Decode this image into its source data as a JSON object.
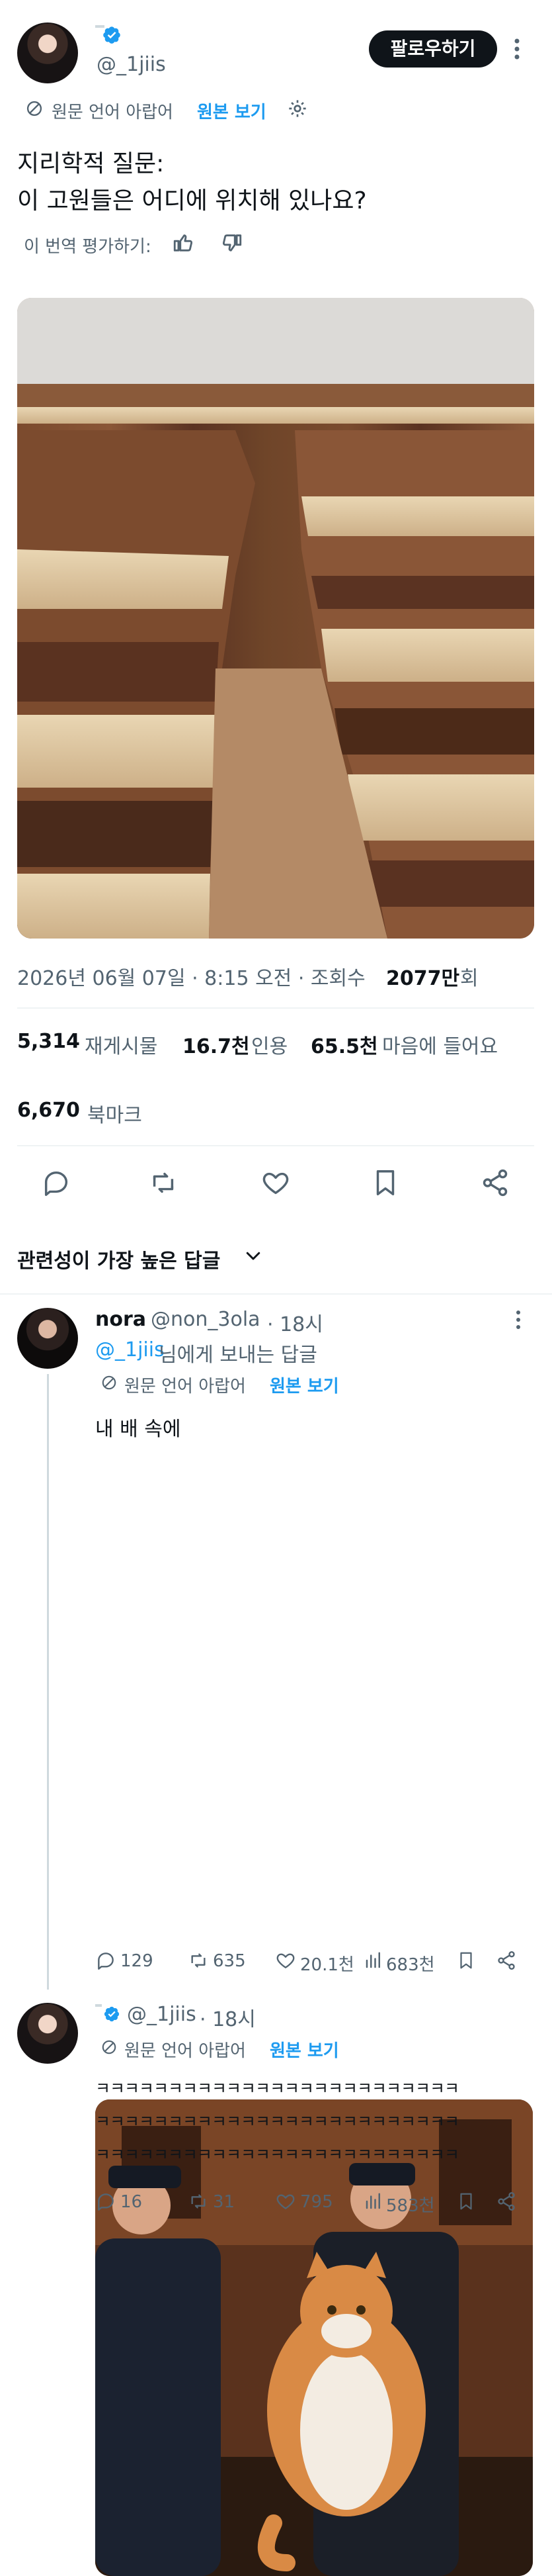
{
  "post": {
    "handle": "@_1jiis",
    "follow_label": "팔로우하기",
    "source_lang": "원문 언어 아랍어",
    "view_original": "원본 보기",
    "body_line1": "지리학적 질문:",
    "body_line2": "이 고원들은 어디에 위치해 있나요?",
    "rate_translation": "이 번역 평가하기:",
    "timestamp": "2026년 06월 07일 · 8:15 오전 · 조회수",
    "views_num": "2077만",
    "views_unit": "회",
    "stats": {
      "reposts_num": "5,314",
      "reposts_label": "재게시물",
      "quotes_num": "16.7천",
      "quotes_label": "인용",
      "likes_num": "65.5천",
      "likes_label": "마음에 들어요",
      "bookmarks_num": "6,670",
      "bookmarks_label": "북마크"
    },
    "sort_label": "관련성이 가장 높은 답글"
  },
  "reply1": {
    "name": "nora",
    "handle": "@non_3ola",
    "time": "· 18시",
    "reply_to_handle": "@_1jiis",
    "reply_to_suffix": " 님에게 보내는 답글",
    "source_lang": "원문 언어 아랍어",
    "view_original": "원본 보기",
    "text": "내 배 속에",
    "actions": {
      "replies": "129",
      "reposts": "635",
      "likes": "20.1천",
      "views": "683천"
    }
  },
  "reply2": {
    "handle": "@_1jiis",
    "time": "· 18시",
    "source_lang": "원문 언어 아랍어",
    "view_original": "원본 보기",
    "text_line1": "ㅋㅋㅋㅋㅋㅋㅋㅋㅋㅋㅋㅋㅋㅋㅋㅋㅋㅋㅋㅋㅋㅋㅋㅋㅋ",
    "text_line2": "ㅋㅋㅋㅋㅋㅋㅋㅋㅋㅋㅋㅋㅋㅋㅋㅋㅋㅋㅋㅋㅋㅋㅋㅋㅋ",
    "text_line3": "ㅋㅋㅋㅋㅋㅋㅋㅋㅋㅋㅋㅋㅋㅋㅋㅋㅋㅋㅋㅋㅋㅋㅋㅋㅋ",
    "actions": {
      "replies": "16",
      "reposts": "31",
      "likes": "795",
      "views": "583천"
    }
  },
  "colors": {
    "accent": "#1d9bf0",
    "text": "#0f1419",
    "muted": "#536471",
    "verified": "#1d9bf0"
  }
}
